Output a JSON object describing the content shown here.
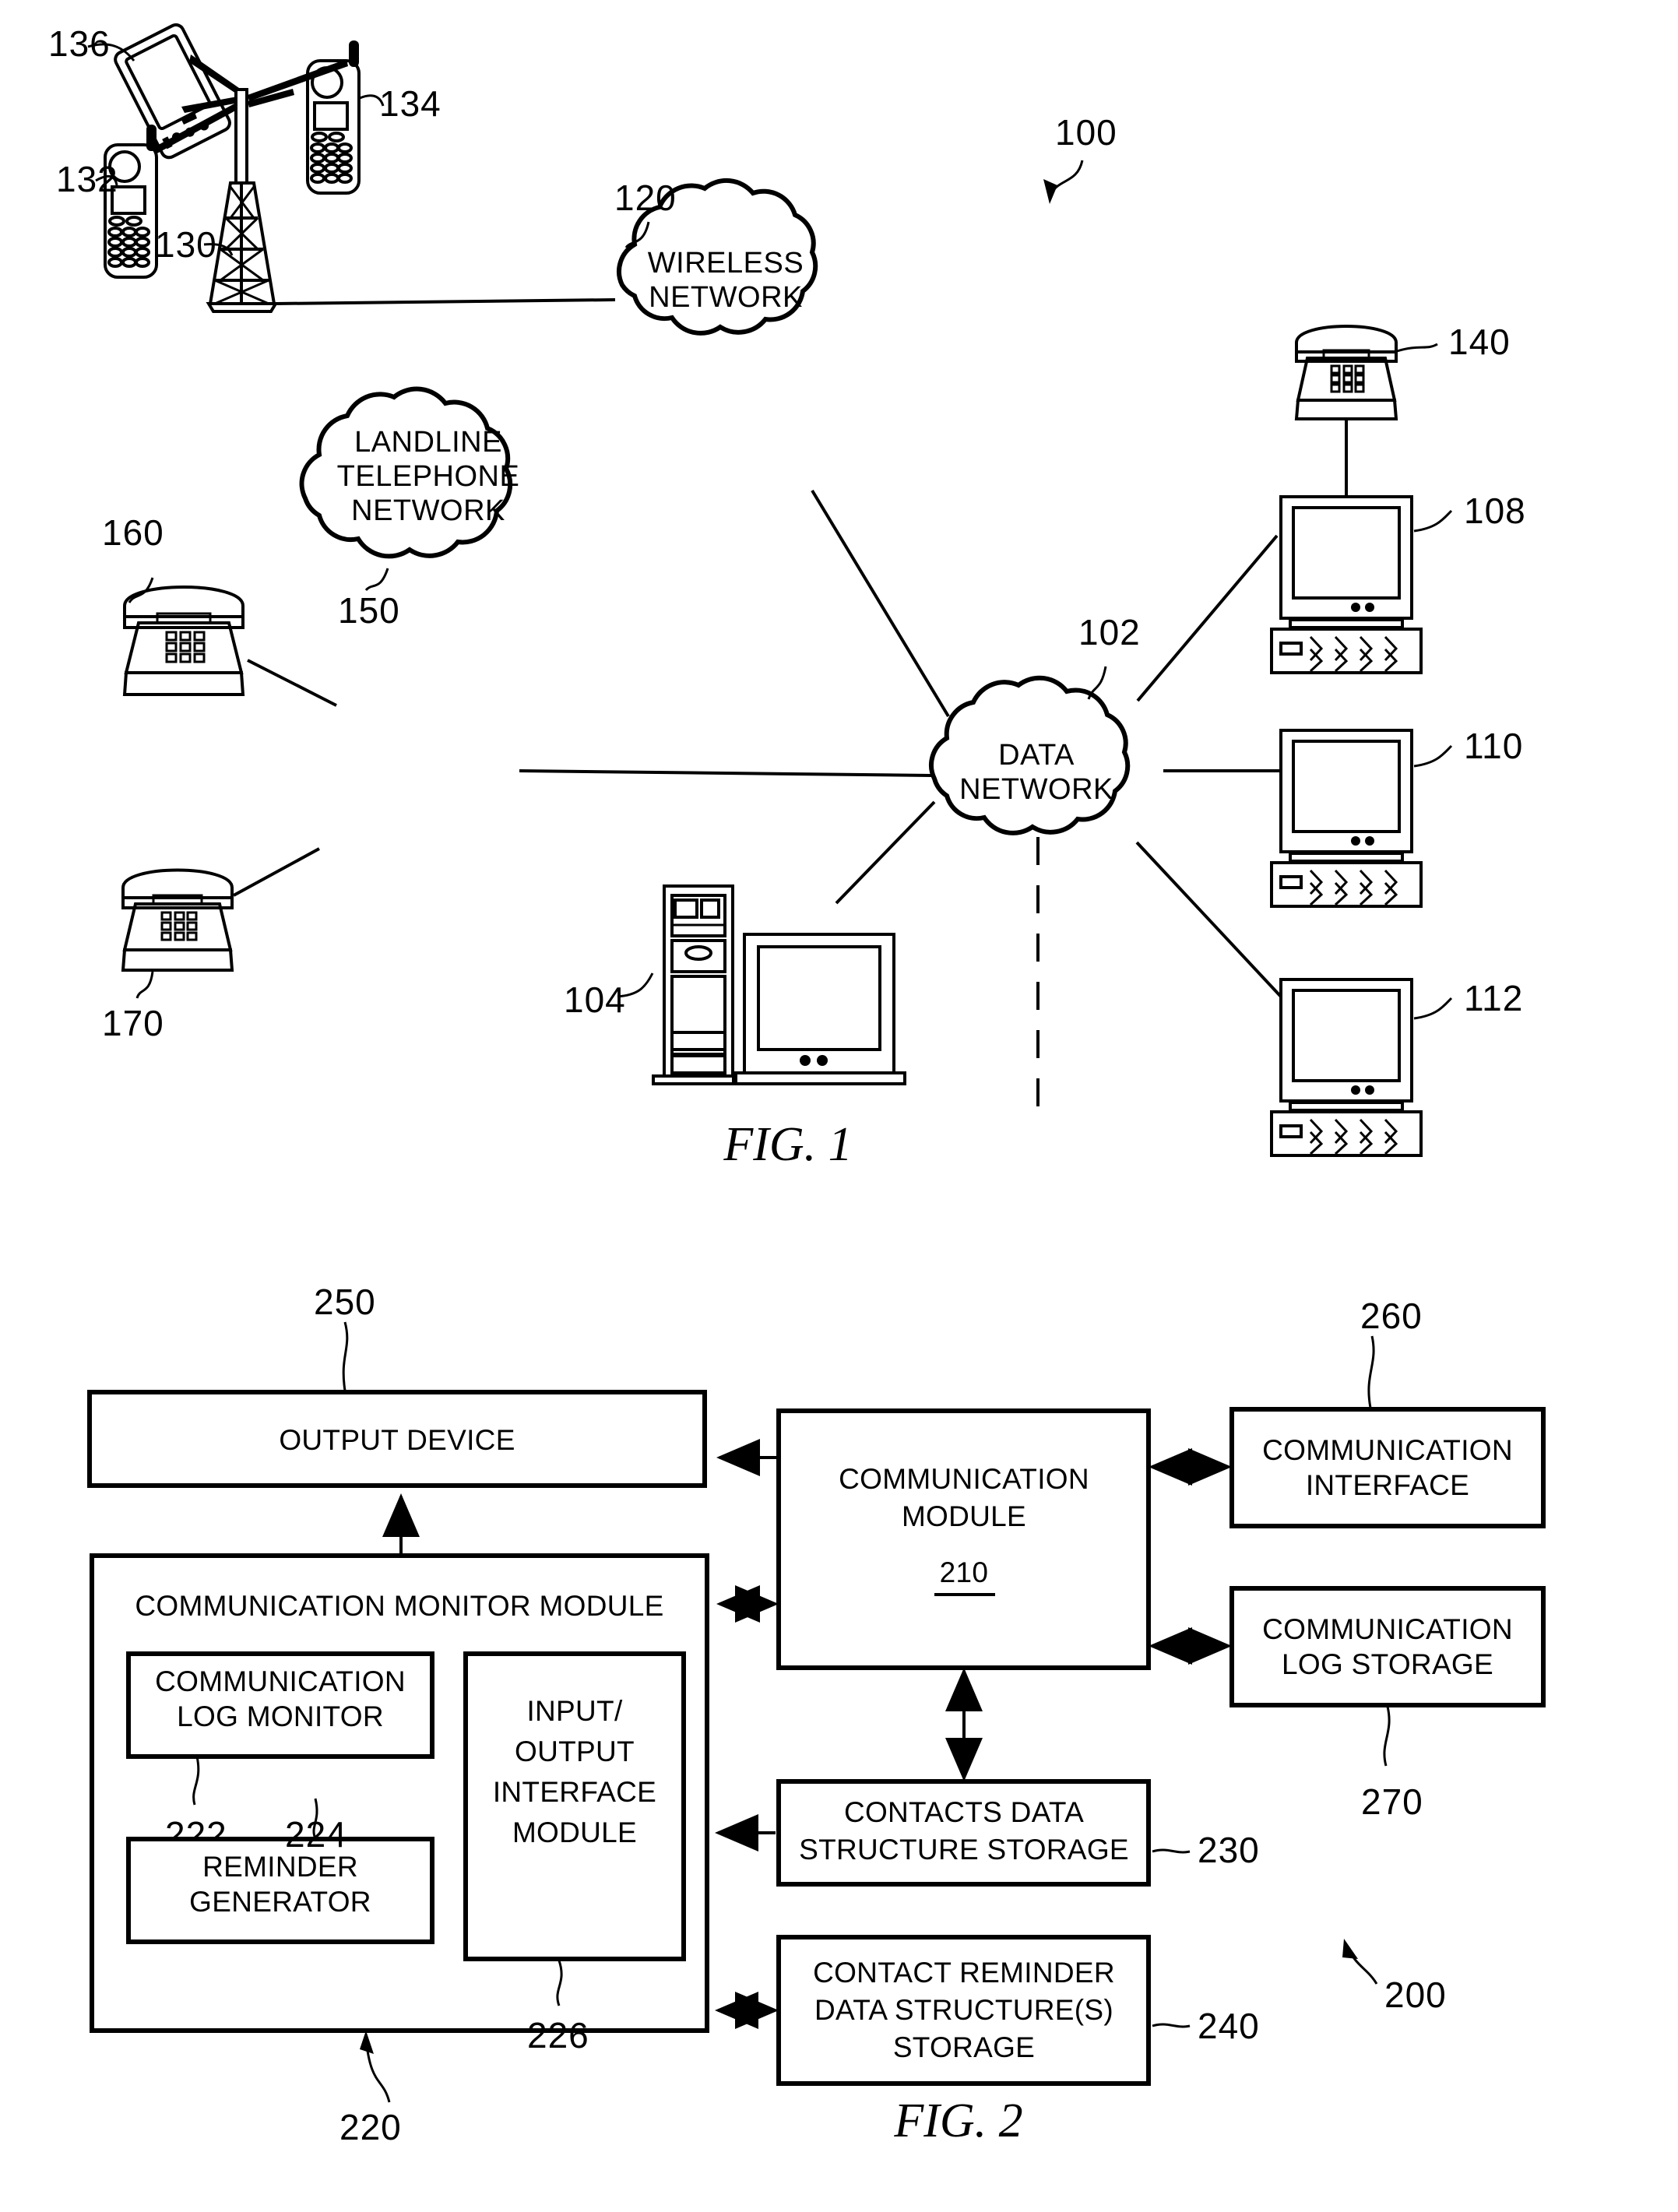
{
  "figures": [
    {
      "id": "fig1",
      "caption": "FIG. 1",
      "system_ref": "100",
      "nodes": {
        "pda": {
          "ref": "136",
          "type": "pda-device"
        },
        "mobile_right": {
          "ref": "134",
          "type": "mobile-phone"
        },
        "mobile_left": {
          "ref": "132",
          "type": "mobile-phone"
        },
        "tower": {
          "ref": "130",
          "type": "cell-tower"
        },
        "wireless_network": {
          "ref": "120",
          "label_line1": "WIRELESS",
          "label_line2": "NETWORK"
        },
        "landline_network": {
          "ref": "150",
          "label_line1": "LANDLINE",
          "label_line2": "TELEPHONE",
          "label_line3": "NETWORK"
        },
        "data_network": {
          "ref": "102",
          "label_line1": "DATA",
          "label_line2": "NETWORK"
        },
        "desk_phone_top": {
          "ref": "160",
          "type": "desk-telephone"
        },
        "desk_phone_bottom": {
          "ref": "170",
          "type": "desk-telephone"
        },
        "server": {
          "ref": "104",
          "type": "server-computer"
        },
        "desk_phone_right": {
          "ref": "140",
          "type": "desk-telephone"
        },
        "computer_top": {
          "ref": "108",
          "type": "desktop-computer"
        },
        "computer_mid": {
          "ref": "110",
          "type": "desktop-computer"
        },
        "computer_bottom": {
          "ref": "112",
          "type": "desktop-computer"
        }
      }
    },
    {
      "id": "fig2",
      "caption": "FIG. 2",
      "system_ref": "200",
      "blocks": {
        "output_device": {
          "ref": "250",
          "label": "OUTPUT DEVICE"
        },
        "monitor_module": {
          "ref": "220",
          "label": "COMMUNICATION MONITOR MODULE"
        },
        "log_monitor": {
          "ref": "222",
          "label_line1": "COMMUNICATION",
          "label_line2": "LOG MONITOR"
        },
        "reminder_generator": {
          "ref": "224",
          "label_line1": "REMINDER",
          "label_line2": "GENERATOR"
        },
        "io_interface": {
          "ref": "226",
          "label_line1": "INPUT/",
          "label_line2": "OUTPUT",
          "label_line3": "INTERFACE",
          "label_line4": "MODULE"
        },
        "communication_module": {
          "ref": "210",
          "label_line1": "COMMUNICATION",
          "label_line2": "MODULE"
        },
        "communication_interface": {
          "ref": "260",
          "label_line1": "COMMUNICATION",
          "label_line2": "INTERFACE"
        },
        "log_storage": {
          "ref": "270",
          "label_line1": "COMMUNICATION",
          "label_line2": "LOG STORAGE"
        },
        "contacts_storage": {
          "ref": "230",
          "label_line1": "CONTACTS DATA",
          "label_line2": "STRUCTURE STORAGE"
        },
        "reminder_storage": {
          "ref": "240",
          "label_line1": "CONTACT REMINDER",
          "label_line2": "DATA STRUCTURE(S)",
          "label_line3": "STORAGE"
        }
      }
    }
  ],
  "colors": {
    "ink": "#000000",
    "paper": "#ffffff"
  }
}
